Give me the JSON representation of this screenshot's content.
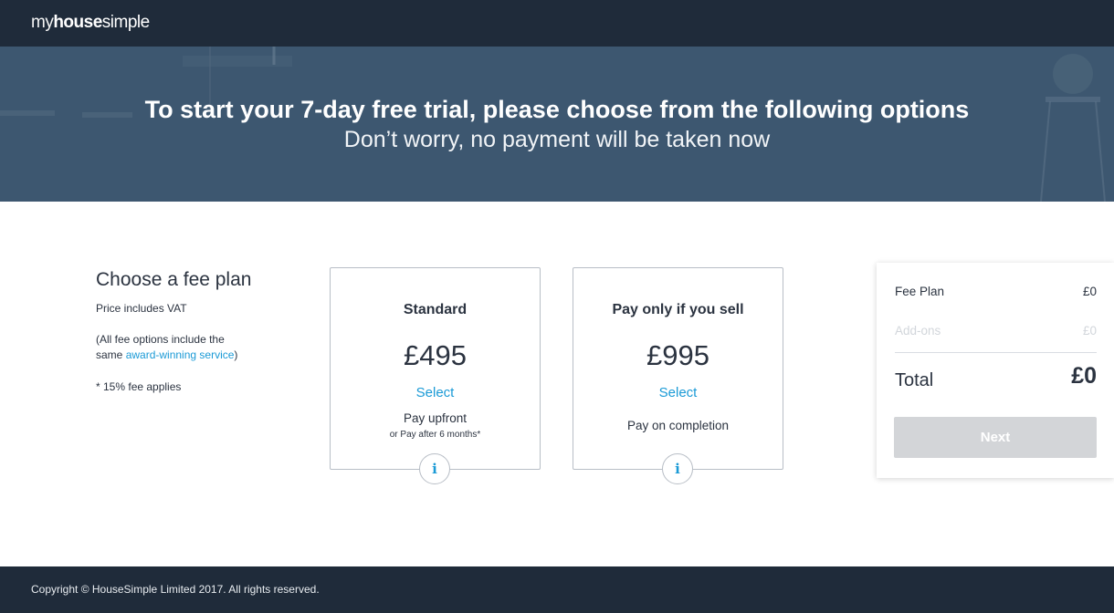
{
  "header": {
    "logo": {
      "my": "my",
      "house": "house",
      "simple": "simple"
    }
  },
  "hero": {
    "title": "To start your 7-day free trial, please choose from the following options",
    "subtitle": "Don’t worry, no payment will be taken now"
  },
  "intro": {
    "heading": "Choose a fee plan",
    "vat": "Price includes VAT",
    "note_before": "(All fee options include the same ",
    "note_link": "award-winning service",
    "note_after": ")",
    "fee_note": "* 15% fee applies"
  },
  "plans": [
    {
      "name": "Standard",
      "price": "£495",
      "select_label": "Select",
      "pay_label": "Pay upfront",
      "alt_label": "or Pay after 6 months*",
      "info_icon": "i"
    },
    {
      "name": "Pay only if you sell",
      "price": "£995",
      "select_label": "Select",
      "pay_label": "Pay on completion",
      "info_icon": "i"
    }
  ],
  "summary": {
    "fee_plan_label": "Fee Plan",
    "fee_plan_value": "£0",
    "addons_label": "Add-ons",
    "addons_value": "£0",
    "total_label": "Total",
    "total_value": "£0",
    "next_label": "Next"
  },
  "footer": {
    "copyright": "Copyright © HouseSimple Limited 2017. All rights reserved."
  },
  "colors": {
    "navbar": "#1f2b3a",
    "hero": "#3d5770",
    "accent": "#1a9ad6",
    "disabled_button": "#d3d5d8"
  }
}
